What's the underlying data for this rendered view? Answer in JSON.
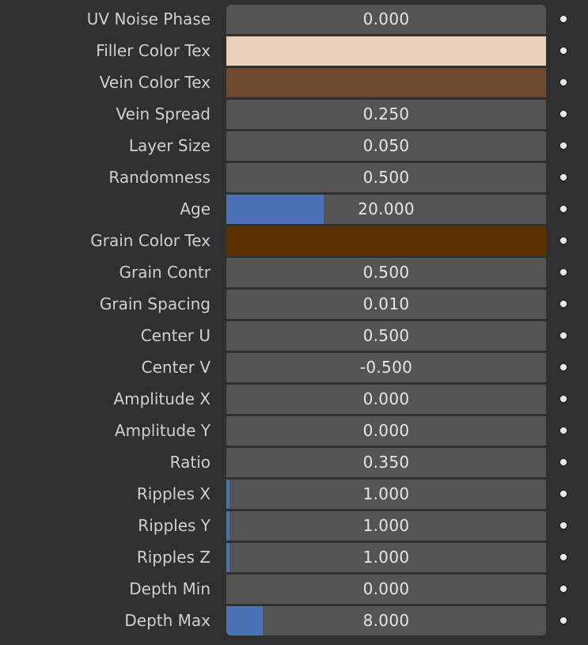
{
  "properties": [
    {
      "id": "uv-noise-phase",
      "label": "UV Noise Phase",
      "type": "number",
      "value": "0.000",
      "fill": 0
    },
    {
      "id": "filler-color-tex",
      "label": "Filler Color Tex",
      "type": "color",
      "color": "#ebd0b9"
    },
    {
      "id": "vein-color-tex",
      "label": "Vein Color Tex",
      "type": "color",
      "color": "#6c4a30"
    },
    {
      "id": "vein-spread",
      "label": "Vein Spread",
      "type": "number",
      "value": "0.250",
      "fill": 0
    },
    {
      "id": "layer-size",
      "label": "Layer Size",
      "type": "number",
      "value": "0.050",
      "fill": 0
    },
    {
      "id": "randomness",
      "label": "Randomness",
      "type": "number",
      "value": "0.500",
      "fill": 0
    },
    {
      "id": "age",
      "label": "Age",
      "type": "number",
      "value": "20.000",
      "fill": 0.305
    },
    {
      "id": "grain-color-tex",
      "label": "Grain Color Tex",
      "type": "color",
      "color": "#5a3101"
    },
    {
      "id": "grain-contr",
      "label": "Grain Contr",
      "type": "number",
      "value": "0.500",
      "fill": 0
    },
    {
      "id": "grain-spacing",
      "label": "Grain Spacing",
      "type": "number",
      "value": "0.010",
      "fill": 0
    },
    {
      "id": "center-u",
      "label": "Center U",
      "type": "number",
      "value": "0.500",
      "fill": 0
    },
    {
      "id": "center-v",
      "label": "Center V",
      "type": "number",
      "value": "-0.500",
      "fill": 0
    },
    {
      "id": "amplitude-x",
      "label": "Amplitude X",
      "type": "number",
      "value": "0.000",
      "fill": 0
    },
    {
      "id": "amplitude-y",
      "label": "Amplitude Y",
      "type": "number",
      "value": "0.000",
      "fill": 0
    },
    {
      "id": "ratio",
      "label": "Ratio",
      "type": "number",
      "value": "0.350",
      "fill": 0
    },
    {
      "id": "ripples-x",
      "label": "Ripples X",
      "type": "number",
      "value": "1.000",
      "fill": 0.01
    },
    {
      "id": "ripples-y",
      "label": "Ripples Y",
      "type": "number",
      "value": "1.000",
      "fill": 0.01
    },
    {
      "id": "ripples-z",
      "label": "Ripples Z",
      "type": "number",
      "value": "1.000",
      "fill": 0.01
    },
    {
      "id": "depth-min",
      "label": "Depth Min",
      "type": "number",
      "value": "0.000",
      "fill": 0
    },
    {
      "id": "depth-max",
      "label": "Depth Max",
      "type": "number",
      "value": "8.000",
      "fill": 0.115
    }
  ],
  "colors": {
    "background": "#303030",
    "field": "#545454",
    "slider_fill": "#4a72b5",
    "label_text": "#d0d0d0",
    "value_text": "#e6e6e6"
  },
  "icons": {
    "keyframe": "keyframe-dot-icon"
  }
}
